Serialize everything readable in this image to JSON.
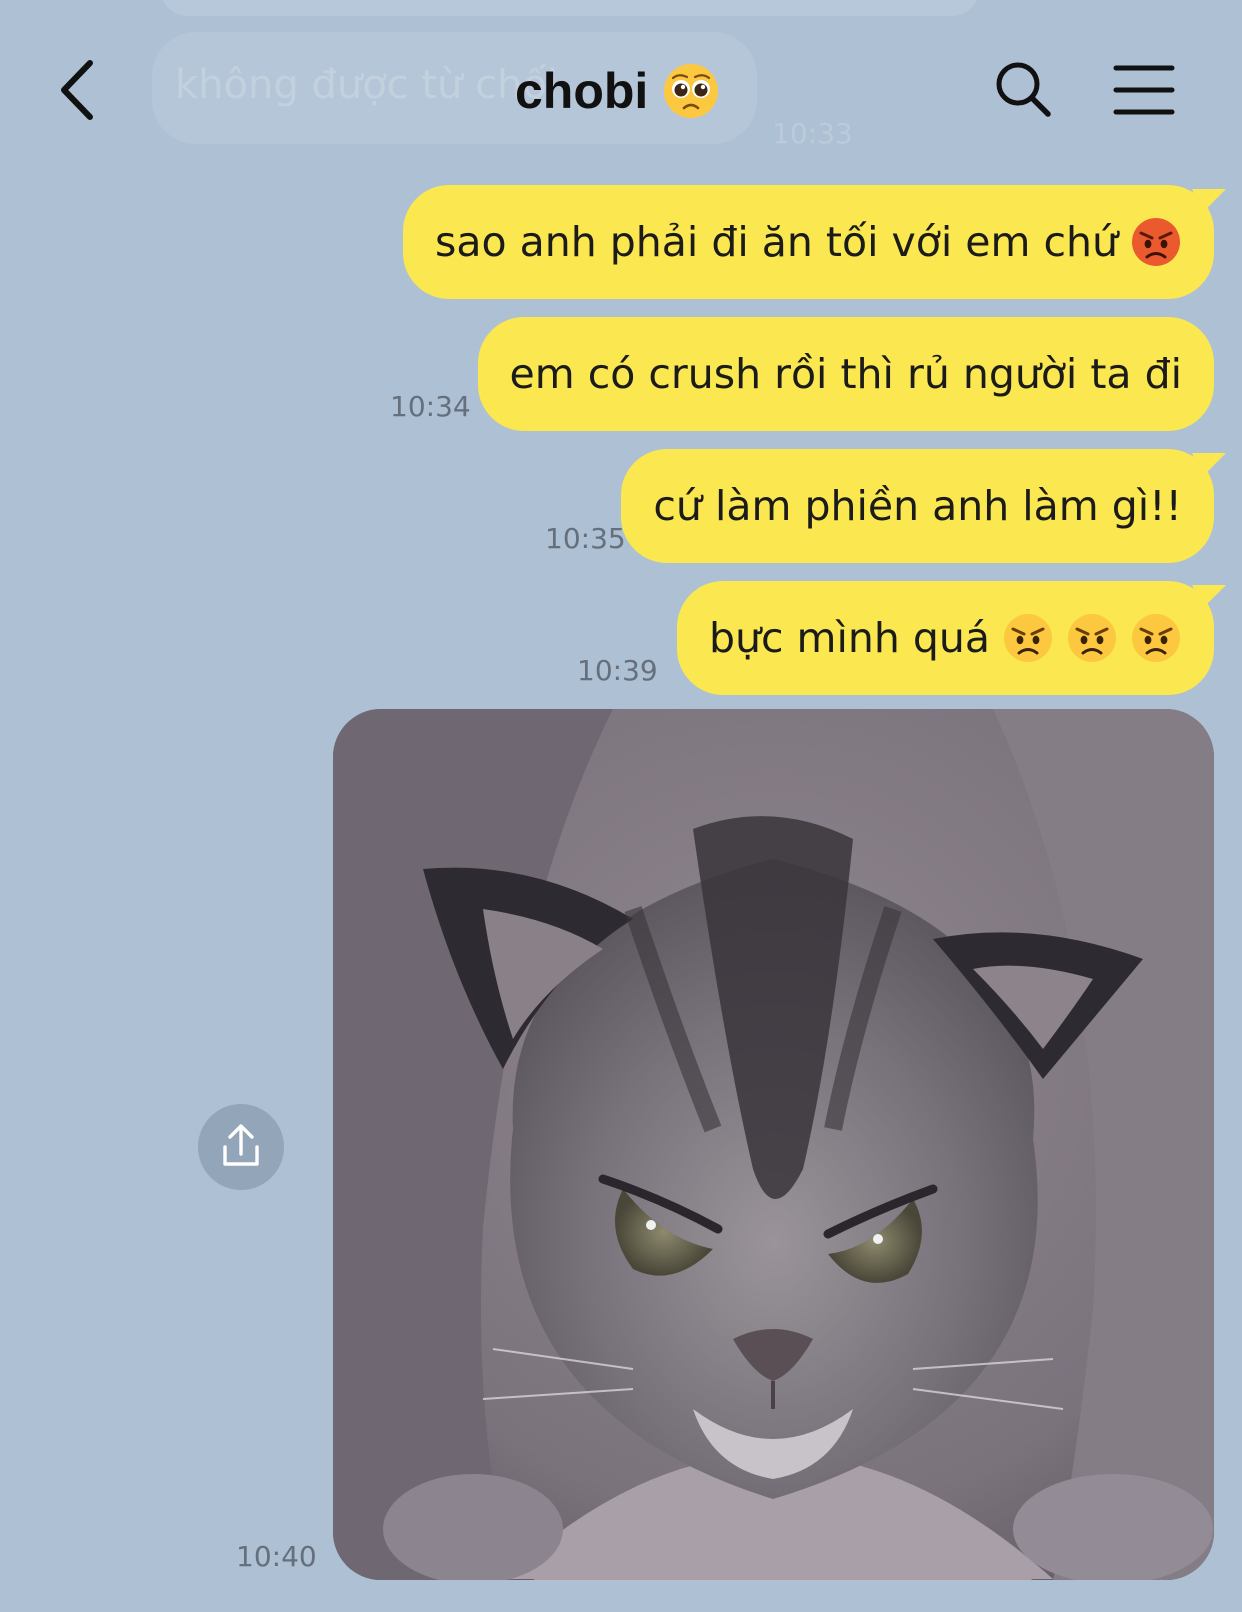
{
  "header": {
    "title": "chobi",
    "title_emoji": "pleading-face-emoji",
    "back_icon": "chevron-left-icon",
    "search_icon": "search-icon",
    "menu_icon": "hamburger-menu-icon"
  },
  "background_partial": {
    "prev_message_text": "không được từ chối",
    "prev_message_time": "10:33"
  },
  "messages": [
    {
      "text": "sao anh phải đi ăn tối với em chứ",
      "emoji": [
        "pouting-face-emoji"
      ],
      "time": ""
    },
    {
      "text": "em có crush rồi thì rủ người ta đi",
      "emoji": [],
      "time": "10:34"
    },
    {
      "text": "cứ làm phiền anh làm gì!!",
      "emoji": [],
      "time": "10:35"
    },
    {
      "text": "bực mình quá",
      "emoji": [
        "angry-face-emoji",
        "angry-face-emoji",
        "angry-face-emoji"
      ],
      "time": "10:39"
    }
  ],
  "photo_message": {
    "subject": "grumpy-kitten-photo",
    "time": "10:40",
    "share_icon": "share-upload-icon"
  },
  "colors": {
    "background": "#adc0d4",
    "outgoing_bubble": "#fbe74f",
    "timestamp": "#66707c"
  }
}
